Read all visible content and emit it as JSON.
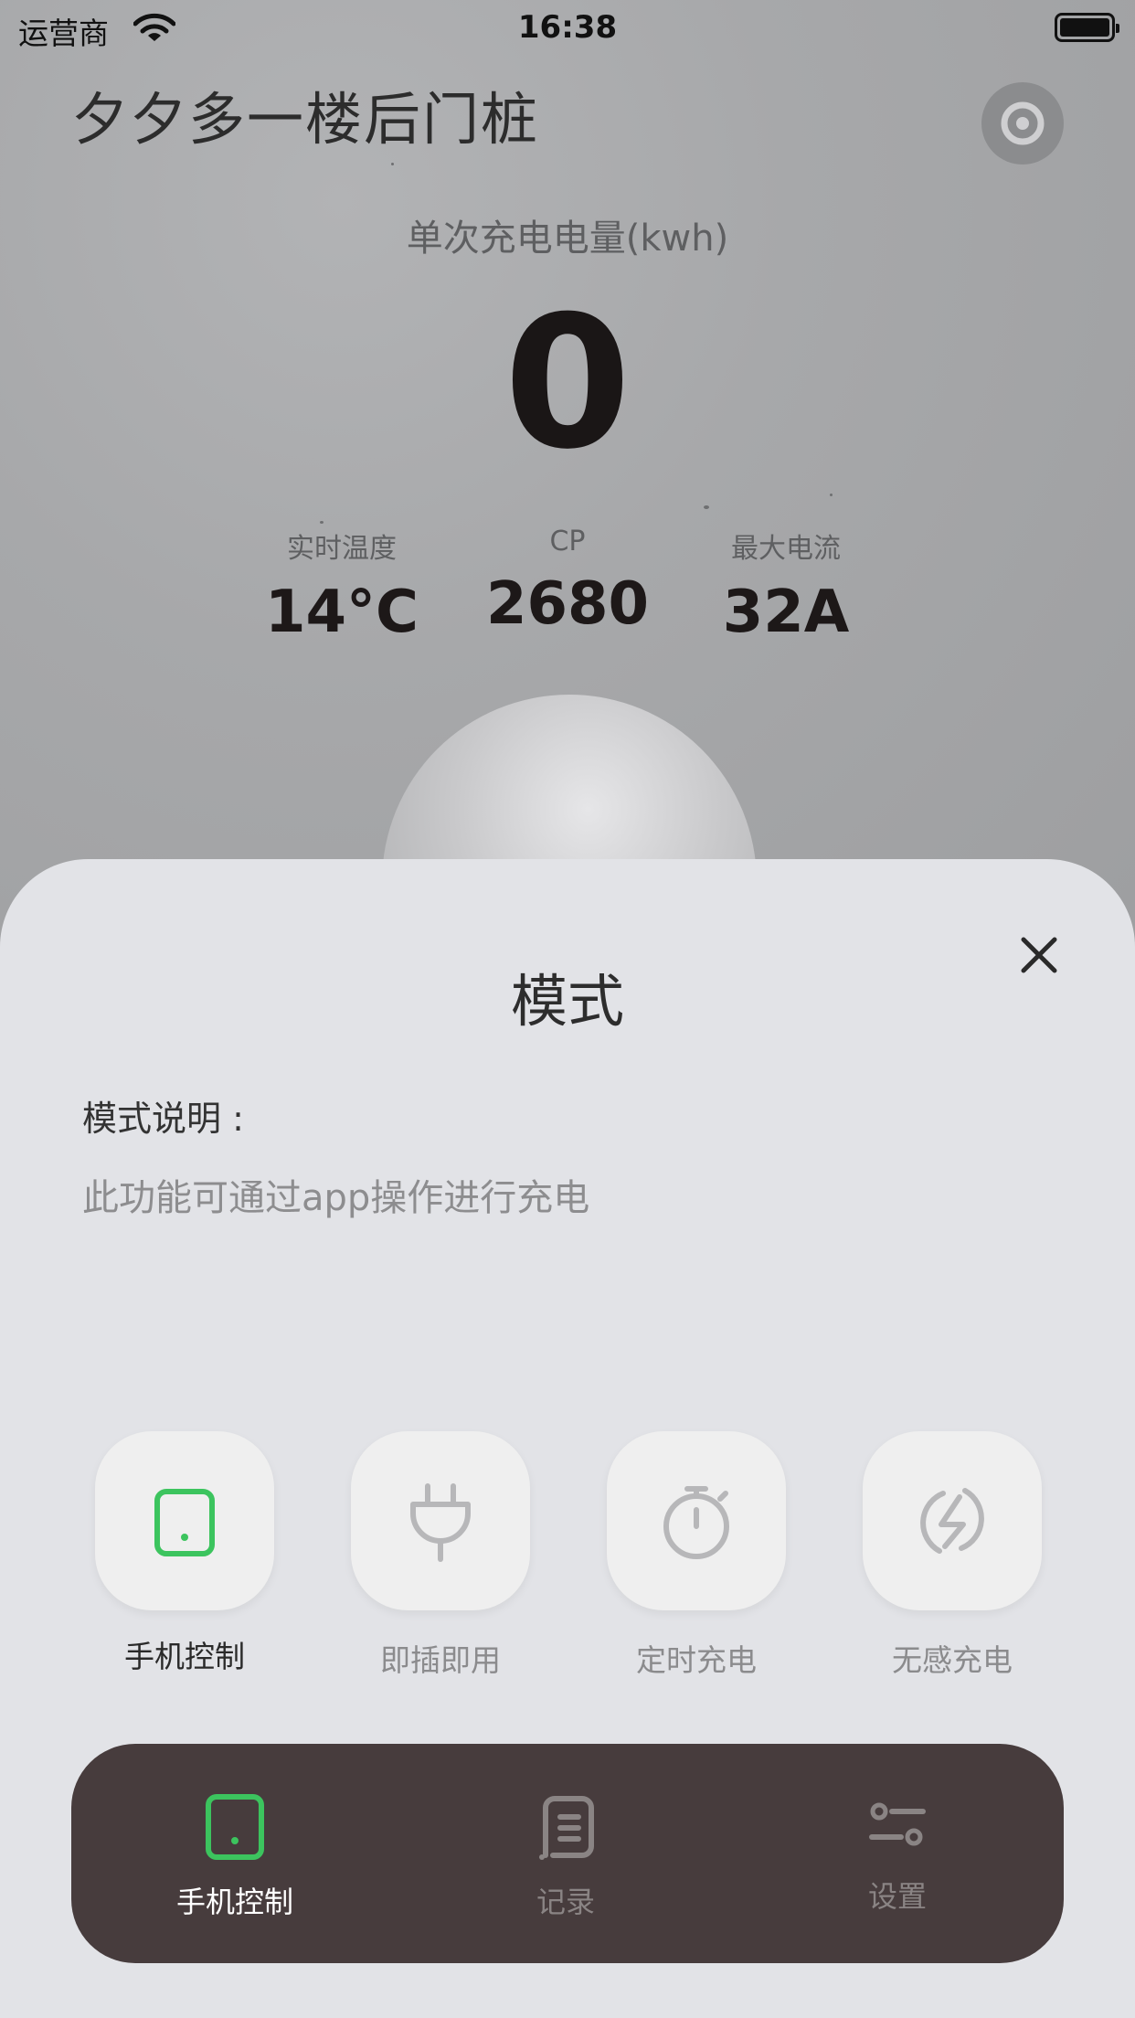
{
  "status_bar": {
    "carrier": "运营商",
    "time": "16:38"
  },
  "header": {
    "station_name": "夕夕多一楼后门桩"
  },
  "energy": {
    "label": "单次充电电量(kwh)",
    "value": "0"
  },
  "stats": [
    {
      "label": "实时温度",
      "value": "14°C"
    },
    {
      "label": "CP",
      "value": "2680"
    },
    {
      "label": "最大电流",
      "value": "32A"
    }
  ],
  "sheet": {
    "title": "模式",
    "desc_label": "模式说明 :",
    "desc_text": "此功能可通过app操作进行充电"
  },
  "modes": [
    {
      "label": "手机控制",
      "icon": "phone-icon",
      "active": true
    },
    {
      "label": "即插即用",
      "icon": "plug-icon",
      "active": false
    },
    {
      "label": "定时充电",
      "icon": "stopwatch-icon",
      "active": false
    },
    {
      "label": "无感充电",
      "icon": "lightning-circle-icon",
      "active": false
    }
  ],
  "tabbar": [
    {
      "label": "手机控制",
      "icon": "phone-icon",
      "active": true
    },
    {
      "label": "记录",
      "icon": "record-list-icon",
      "active": false
    },
    {
      "label": "设置",
      "icon": "sliders-icon",
      "active": false
    }
  ],
  "colors": {
    "accent": "#3cc45e",
    "tabbar_bg": "#473c3d",
    "sheet_bg": "#e2e3e7"
  }
}
